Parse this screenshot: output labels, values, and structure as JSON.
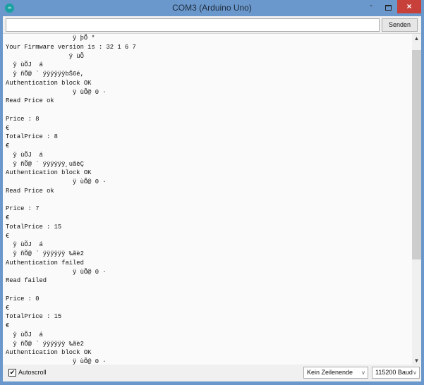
{
  "window": {
    "title": "COM3 (Arduino Uno)",
    "icon": "arduino-icon",
    "min": "-",
    "close": "×"
  },
  "input": {
    "value": "",
    "send_label": "Senden"
  },
  "output": {
    "lines": [
      "                  ÿ þÕ *",
      "Your Firmware version is : 32 1 6 7",
      "                 ÿ ùÕ",
      "  ÿ ùÕJ  á",
      "  ÿ ñÕ@ ` ÿÿÿÿÿÿbŠ6é,",
      "Authentication block OK",
      "                  ÿ ùÕ@ 0 ·",
      "Read Price ok",
      "",
      "Price : 8",
      "€",
      "TotalPrice : 8",
      "€",
      "  ÿ ùÕJ  á",
      "  ÿ ñÕ@ ` ÿÿÿÿÿÿ¸uãèÇ",
      "Authentication block OK",
      "                  ÿ ùÕ@ 0 ·",
      "Read Price ok",
      "",
      "Price : 7",
      "€",
      "TotalPrice : 15",
      "€",
      "  ÿ ùÕJ  á",
      "  ÿ ñÕ@ ` ÿÿÿÿÿÿ ‰ãè2",
      "Authentication failed",
      "                  ÿ ùÕ@ 0 ·",
      "Read failed",
      "",
      "Price : 0",
      "€",
      "TotalPrice : 15",
      "€",
      "  ÿ ùÕJ  á",
      "  ÿ ñÕ@ ` ÿÿÿÿÿÿ ‰ãè2",
      "Authentication block OK",
      "                  ÿ ùÕ@ 0 ·"
    ]
  },
  "footer": {
    "autoscroll_label": "Autoscroll",
    "autoscroll_checked": true,
    "line_ending": "Kein Zeilenende",
    "baud": "115200 Baud"
  }
}
